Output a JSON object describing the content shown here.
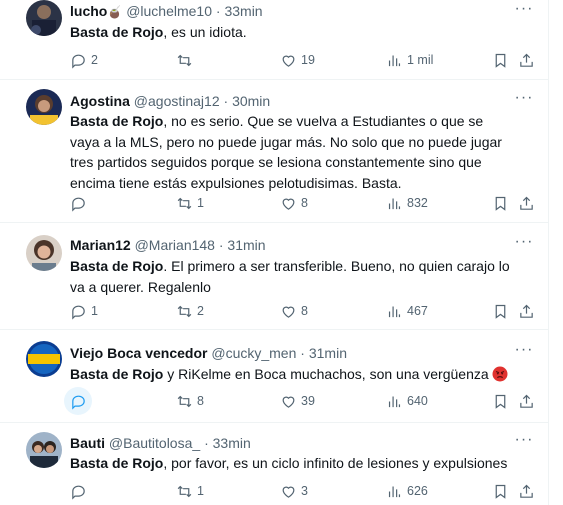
{
  "tweets": [
    {
      "name": "lucho",
      "name_emoji": "🧉",
      "handle": "@luchelme10",
      "time": "33min",
      "bold": "Basta de Rojo",
      "text": ", es un idiota.",
      "replies": "2",
      "retweets": "",
      "likes": "19",
      "views": "1 mil"
    },
    {
      "name": "Agostina",
      "handle": "@agostinaj12",
      "time": "30min",
      "bold": "Basta de Rojo",
      "text": ", no es serio. Que se vuelva a Estudiantes o que se vaya a la MLS, pero no puede jugar más. No solo que no puede jugar tres partidos seguidos porque se lesiona constantemente sino que encima tiene estás expulsiones pelotudisimas. Basta.",
      "replies": "",
      "retweets": "1",
      "likes": "8",
      "views": "832"
    },
    {
      "name": "Marian12",
      "handle": "@Marian148",
      "time": "31min",
      "bold": "Basta de Rojo",
      "text": ".  El primero a ser transferible. Bueno, no quien carajo lo va a querer. Regalenlo",
      "replies": "1",
      "retweets": "2",
      "likes": "8",
      "views": "467"
    },
    {
      "name": "Viejo Boca vencedor",
      "handle": "@cucky_men",
      "time": "31min",
      "bold": "Basta de Rojo",
      "text": " y RiKelme en Boca muchachos, son una vergüenza",
      "text_emoji": "angry-face",
      "replies": "",
      "retweets": "8",
      "likes": "39",
      "views": "640"
    },
    {
      "name": "Bauti",
      "handle": "@Bautitolosa_",
      "time": "33min",
      "bold": "Basta de Rojo",
      "text": ", por favor, es un ciclo infinito de lesiones y expulsiones",
      "replies": "",
      "retweets": "1",
      "likes": "3",
      "views": "626"
    }
  ],
  "separator": "·",
  "more_glyph": "···",
  "icons": {
    "reply": "speech-bubble-icon",
    "retweet": "retweet-arrows-icon",
    "like": "heart-icon",
    "views": "bar-chart-icon",
    "bookmark": "bookmark-icon",
    "share": "share-upload-icon",
    "more": "more-dots-icon"
  },
  "colors": {
    "text": "#0f1419",
    "secondary": "#536471",
    "accent": "#1d9bf0",
    "divider": "#eff3f4",
    "reply_highlight": "#e8f5fd"
  }
}
